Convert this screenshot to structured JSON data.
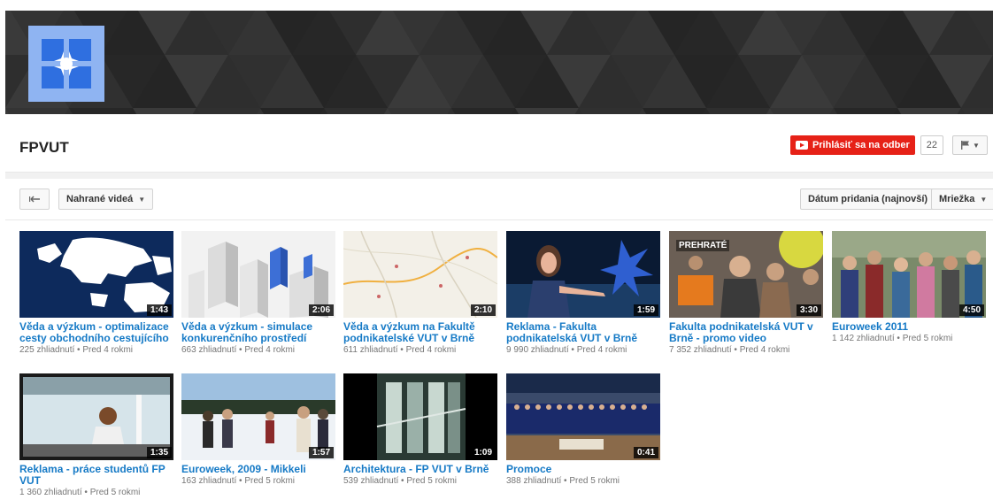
{
  "channel": {
    "name": "FPVUT",
    "subscribe_label": "Prihlásiť sa na odber",
    "subscriber_count": "22"
  },
  "controls": {
    "uploads_label": "Nahrané videá",
    "sort_label": "Dátum pridania (najnovší)",
    "view_label": "Mriežka"
  },
  "colors": {
    "link": "#167ac6",
    "subscribe": "#e62117",
    "avatar": "#8fb4f2",
    "banner": "#2b2b2b"
  },
  "videos": [
    {
      "title": "Věda a výzkum - optimalizace cesty obchodního cestujícího",
      "views": "225 zhliadnutí",
      "age": "Pred 4 rokmi",
      "duration": "1:43"
    },
    {
      "title": "Věda a výzkum - simulace konkurenčního prostředí",
      "views": "663 zhliadnutí",
      "age": "Pred 4 rokmi",
      "duration": "2:06"
    },
    {
      "title": "Věda a výzkum na Fakultě podnikatelské VUT v Brně",
      "views": "611 zhliadnutí",
      "age": "Pred 4 rokmi",
      "duration": "2:10"
    },
    {
      "title": "Reklama - Fakulta podnikatelská VUT v Brně",
      "views": "9 990 zhliadnutí",
      "age": "Pred 4 rokmi",
      "duration": "1:59"
    },
    {
      "title": "Fakulta podnikatelská VUT v Brně - promo video",
      "views": "7 352 zhliadnutí",
      "age": "Pred 4 rokmi",
      "duration": "3:30",
      "overlay": "PREHRATÉ"
    },
    {
      "title": "Euroweek 2011",
      "views": "1 142 zhliadnutí",
      "age": "Pred 5 rokmi",
      "duration": "4:50"
    },
    {
      "title": "Reklama - práce studentů FP VUT",
      "views": "1 360 zhliadnutí",
      "age": "Pred 5 rokmi",
      "duration": "1:35"
    },
    {
      "title": "Euroweek, 2009 - Mikkeli",
      "views": "163 zhliadnutí",
      "age": "Pred 5 rokmi",
      "duration": "1:57"
    },
    {
      "title": "Architektura - FP VUT v Brně",
      "views": "539 zhliadnutí",
      "age": "Pred 5 rokmi",
      "duration": "1:09"
    },
    {
      "title": "Promoce",
      "views": "388 zhliadnutí",
      "age": "Pred 5 rokmi",
      "duration": "0:41"
    }
  ]
}
